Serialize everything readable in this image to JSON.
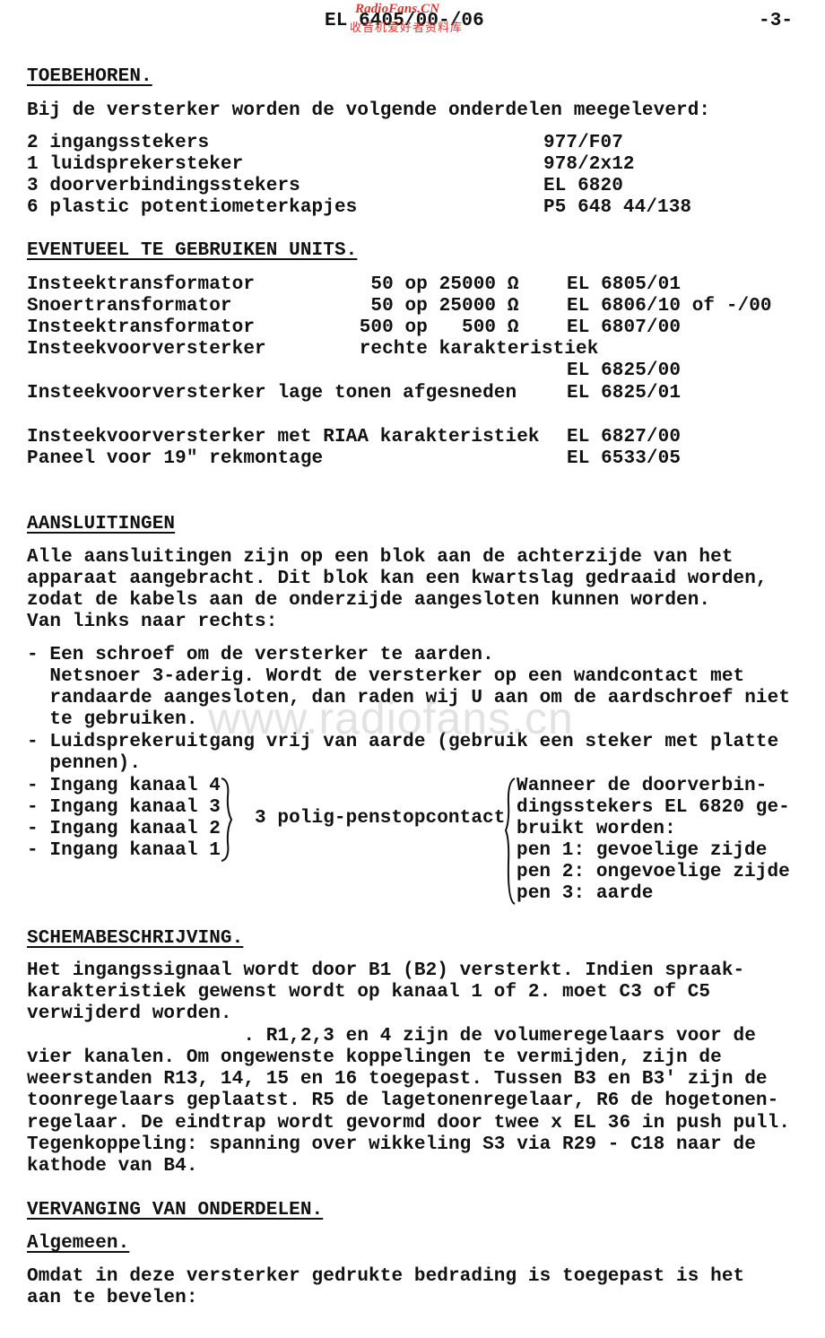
{
  "header": {
    "doc_number": "EL 6405/00-/06",
    "page_number": "-3-",
    "watermark_top_en": "RadioFans.CN",
    "watermark_top_cn": "收音机爱好者资料库",
    "watermark_center": "www.radiofans.cn"
  },
  "toebehoren": {
    "heading": "TOEBEHOREN.",
    "intro": "Bij de versterker worden de volgende onderdelen meegeleverd:",
    "items": [
      {
        "qty_desc": "2 ingangsstekers",
        "code": "977/F07"
      },
      {
        "qty_desc": "1 luidsprekersteker",
        "code": "978/2x12"
      },
      {
        "qty_desc": "3 doorverbindingsstekers",
        "code": "EL 6820"
      },
      {
        "qty_desc": "6 plastic potentiometerkapjes",
        "code": "P5 648 44/138"
      }
    ]
  },
  "units": {
    "heading": "EVENTUEEL TE GEBRUIKEN UNITS.",
    "rows": [
      {
        "name": "Insteektransformator",
        "spec": "  50 op 25000 Ω",
        "code": "EL 6805/01"
      },
      {
        "name": "Snoertransformator",
        "spec": "  50 op 25000 Ω",
        "code": "EL 6806/10 of -/00"
      },
      {
        "name": "Insteektransformator",
        "spec": " 500 op   500 Ω",
        "code": "EL 6807/00"
      },
      {
        "name": "Insteekvoorversterker",
        "spec": " rechte karakteristiek",
        "code": ""
      },
      {
        "name": "",
        "spec": "",
        "code": "EL 6825/00"
      },
      {
        "name": "Insteekvoorversterker lage tonen afgesneden",
        "spec": "",
        "code": "EL 6825/01"
      },
      {
        "name": "Insteekvoorversterker met RIAA karakteristiek",
        "spec": "",
        "code": "EL 6827/00"
      },
      {
        "name": "Paneel voor 19\" rekmontage",
        "spec": "",
        "code": "EL 6533/05"
      }
    ]
  },
  "aansluitingen": {
    "heading": "AANSLUITINGEN",
    "paragraph": [
      "Alle aansluitingen zijn op een blok aan de achterzijde van het",
      "apparaat aangebracht. Dit blok kan een kwartslag gedraaid worden,",
      "zodat de kabels aan de onderzijde aangesloten kunnen worden.",
      "Van links naar rechts:"
    ],
    "bullets": [
      [
        "- Een schroef om de versterker te aarden.",
        "  Netsnoer 3-aderig. Wordt de versterker op een wandcontact met",
        "  randaarde aangesloten, dan raden wij U aan om de aardschroef niet",
        "  te gebruiken."
      ],
      [
        "- Luidsprekeruitgang vrij van aarde (gebruik een steker met platte",
        "  pennen)."
      ]
    ],
    "inputs": [
      "- Ingang kanaal 4",
      "- Ingang kanaal 3",
      "- Ingang kanaal 2",
      "- Ingang kanaal 1"
    ],
    "connector_label": "3 polig-penstopcontact",
    "notes": [
      "Wanneer de doorverbin-",
      "dingsstekers EL 6820 ge-",
      "bruikt worden:",
      "pen 1: gevoelige zijde",
      "pen 2: ongevoelige zijde",
      "pen 3: aarde"
    ]
  },
  "schema": {
    "heading": "SCHEMABESCHRIJVING.",
    "lines": [
      "Het ingangssignaal wordt door B1 (B2) versterkt. Indien spraak-",
      "karakteristiek gewenst wordt op kanaal 1 of 2. moet C3 of C5",
      "verwijderd worden.",
      "                   . R1,2,3 en 4 zijn de volumeregelaars voor de",
      "vier kanalen. Om ongewenste koppelingen te vermijden, zijn de",
      "weerstanden R13, 14, 15 en 16 toegepast. Tussen B3 en B3' zijn de",
      "toonregelaars geplaatst. R5 de lagetonenregelaar, R6 de hogetonen-",
      "regelaar. De eindtrap wordt gevormd door twee x EL 36 in push pull.",
      "Tegenkoppeling: spanning over wikkeling S3 via R29 - C18 naar de",
      "kathode van B4."
    ]
  },
  "vervanging": {
    "heading": "VERVANGING VAN ONDERDELEN.",
    "subheading": "Algemeen.",
    "lines": [
      "Omdat in deze versterker gedrukte bedrading is toegepast is het",
      "aan te bevelen:"
    ]
  }
}
